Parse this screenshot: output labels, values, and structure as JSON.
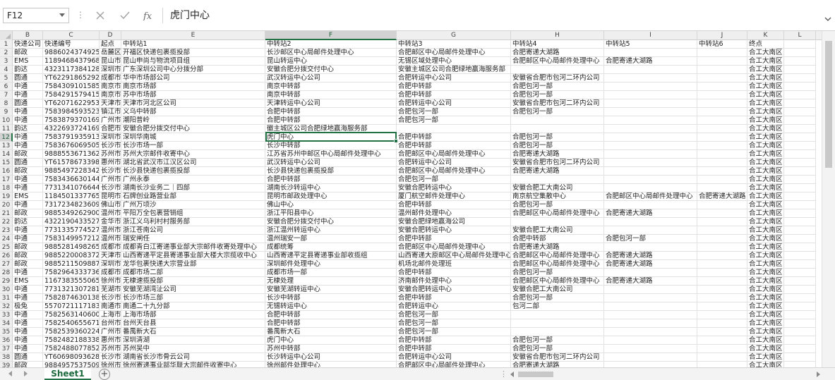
{
  "namebox": "F12",
  "formula": "虎门中心",
  "sheet_tab": "Sheet1",
  "add_sheet": "+",
  "columns": [
    "B",
    "C",
    "D",
    "E",
    "F",
    "G",
    "H",
    "I",
    "J",
    "K",
    "L"
  ],
  "selected_column": "F",
  "selected_row": "12",
  "rows": [
    {
      "n": "1",
      "c": [
        "快递公司",
        "快递编号",
        "起点",
        "中转站1",
        "中转站2",
        "中转站3",
        "中转站4",
        "中转站5",
        "中转站6",
        "终点",
        ""
      ]
    },
    {
      "n": "2",
      "c": [
        "邮政",
        "9886024374925",
        "岳麓区",
        "开福区快递包裹揽投部",
        "长沙邮区中心局邮件处理中心",
        "合肥邮区中心局邮件处理中心",
        "合肥寄递大湖路",
        "",
        "",
        "合工大南区",
        ""
      ]
    },
    {
      "n": "3",
      "c": [
        "EMS",
        "1189468437968",
        "昆山市",
        "昆山申尚与物流项目组",
        "昆山转运中心",
        "无锡区域处理中心",
        "合肥邮区中心局邮件处理中心",
        "合肥寄递大湖路",
        "",
        "合工大南区",
        ""
      ]
    },
    {
      "n": "4",
      "c": [
        "韵达",
        "432311738412858",
        "深圳市",
        "广东深圳公司中心分拨分部",
        "安徽合肥分拨交付中心",
        "安徽主城区公司合肥绿地赢海服务部",
        "",
        "",
        "",
        "合工大南区",
        ""
      ]
    },
    {
      "n": "5",
      "c": [
        "圆通",
        "YT6229186529207",
        "成都市",
        "华中市场部公司",
        "武汉转运中心公司",
        "合肥转运中心公司",
        "安徽省合肥市包河二环内公司",
        "",
        "",
        "合工大南区",
        ""
      ]
    },
    {
      "n": "6",
      "c": [
        "中通",
        "75843091015853",
        "南京市",
        "南京市场部",
        "南京中转部",
        "合肥中转部",
        "合肥包河一部",
        "",
        "",
        "合工大南区",
        ""
      ]
    },
    {
      "n": "7",
      "c": [
        "中通",
        "75842915794157",
        "南京市",
        "苏中市场部",
        "南京中转部",
        "合肥中转部",
        "合肥包河一部",
        "",
        "",
        "合工大南区",
        ""
      ]
    },
    {
      "n": "8",
      "c": [
        "圆通",
        "YT6207162295369",
        "天津市",
        "天津市河北区公司",
        "天津转运中心公司",
        "合肥转运中心公司",
        "安徽省合肥市包河二环内公司",
        "",
        "",
        "合工大南区",
        ""
      ]
    },
    {
      "n": "9",
      "c": [
        "中通",
        "75839845935236",
        "镇江市",
        "义乌中转部",
        "合肥中转部",
        "合肥包河一部",
        "合肥包河一部",
        "",
        "",
        "合工大南区",
        ""
      ]
    },
    {
      "n": "10",
      "c": [
        "中通",
        "75838793701692",
        "广州市",
        "潮阳普岭",
        "合肥中转部",
        "合肥包河一部",
        "",
        "",
        "",
        "合工大南区",
        ""
      ]
    },
    {
      "n": "11",
      "c": [
        "韵达",
        "432269372416914",
        "合肥市",
        "安徽合肥分拨交付中心",
        "徽主城区公司合肥绿地赢海服务部",
        "",
        "",
        "",
        "",
        "合工大南区",
        ""
      ]
    },
    {
      "n": "12",
      "c": [
        "中通",
        "75837919359133",
        "深圳市",
        "深圳华南城",
        "虎门中心",
        "合肥中转部",
        "合肥包河一部",
        "",
        "",
        "合工大南区",
        ""
      ]
    },
    {
      "n": "13",
      "c": [
        "中通",
        "75836760695054",
        "长沙市",
        "长沙市场一部",
        "长沙中转部",
        "合肥中转部",
        "合肥包河一部",
        "",
        "",
        "合工大南区",
        ""
      ]
    },
    {
      "n": "14",
      "c": [
        "邮政",
        "9888553671362",
        "苏州市",
        "苏州大宗邮件收寄中心",
        "江苏省苏州中邮区中心局邮件处理中心",
        "合肥邮区中心局邮件处理中心",
        "合肥寄递大湖路",
        "",
        "",
        "合工大南区",
        ""
      ]
    },
    {
      "n": "15",
      "c": [
        "圆通",
        "YT6157867339867",
        "惠州市",
        "湖北省武汉市江汉区公司",
        "武汉转运中心公司",
        "合肥转运中心公司",
        "安徽省合肥市包河二环内公司",
        "",
        "",
        "合工大南区",
        ""
      ]
    },
    {
      "n": "16",
      "c": [
        "邮政",
        "9885497228342",
        "长沙市",
        "长沙县快递包裹揽投部",
        "长沙县快递包裹揽投部",
        "合肥邮区中心局邮件处理中心",
        "合肥寄递大湖路",
        "",
        "",
        "合工大南区",
        ""
      ]
    },
    {
      "n": "17",
      "c": [
        "中通",
        "75834366301446",
        "广州市",
        "广州永泰",
        "合肥中转部",
        "合肥包河一部",
        "",
        "",
        "",
        "合工大南区",
        ""
      ]
    },
    {
      "n": "18",
      "c": [
        "中通",
        "773134107664496",
        "长沙市",
        "湖南长沙业务二｜四部",
        "湖南长沙转运中心",
        "安徽合肥转运中心",
        "安徽合肥工大南公司",
        "",
        "",
        "合工大南区",
        ""
      ]
    },
    {
      "n": "19",
      "c": [
        "EMS",
        "1184501337765",
        "昆明市",
        "石牌创业路营业部",
        "昆明市邮政处理中心",
        "厦门航空邮件处理中心",
        "南京航空集散中心",
        "合肥邮区中心局邮件处理中心",
        "合肥寄递大湖路",
        "合工大南区",
        ""
      ]
    },
    {
      "n": "20",
      "c": [
        "中通",
        "73172348236092",
        "佛山市",
        "广州万顷沙",
        "佛山中心",
        "合肥中转部",
        "合肥包河一部",
        "",
        "",
        "合工大南区",
        ""
      ]
    },
    {
      "n": "21",
      "c": [
        "邮政",
        "9885349262900",
        "温州市",
        "平阳万全包裹营销组",
        "浙江平阳县中心",
        "温州邮件处理中心",
        "合肥邮区中心局邮件处理中心",
        "合肥寄递大湖路",
        "",
        "合工大南区",
        ""
      ]
    },
    {
      "n": "22",
      "c": [
        "韵达",
        "432219043352741",
        "金华市",
        "浙江义乌利村村服务部",
        "安徽合肥分拨交付中心",
        "安徽合肥绿地赢海公司",
        "",
        "",
        "",
        "合工大南区",
        ""
      ]
    },
    {
      "n": "23",
      "c": [
        "中通",
        "773133577452721",
        "温州市",
        "浙江苍南公司",
        "浙江温州转运中心",
        "安徽合肥转运中心",
        "安徽合肥工大南公司",
        "",
        "",
        "合工大南区",
        ""
      ]
    },
    {
      "n": "24",
      "c": [
        "中通",
        "75831499572125",
        "温州市",
        "瑞安闸任",
        "温州瑞安一部",
        "合肥中转部",
        "合肥中转部",
        "合肥包河一部",
        "",
        "合工大南区",
        ""
      ]
    },
    {
      "n": "25",
      "c": [
        "邮政",
        "9885281498265",
        "成都市",
        "成都青白江寄递事业部大宗邮件收寄处理中心",
        "成都统筹",
        "合肥邮区中心局邮件处理中心",
        "合肥寄递大湖路",
        "",
        "",
        "合工大南区",
        ""
      ]
    },
    {
      "n": "26",
      "c": [
        "邮政",
        "9885220008372",
        "天津市",
        "山西寄递平定县寄递事业部大楼大宗揽收中心",
        "山西寄递平定县寄递事业部收揽组",
        "山西寄递大原邮区中心局邮件处理中心",
        "合肥邮区中心局邮件处理中心",
        "合肥寄递大湖路",
        "",
        "合工大南区",
        ""
      ]
    },
    {
      "n": "27",
      "c": [
        "邮政",
        "9885211509887",
        "深圳市",
        "龙华包裹快递大宗营业部",
        "深圳邮件处理中心",
        "机场北邮件处理班",
        "合肥邮区中心局邮件处理中心",
        "合肥寄递大湖路",
        "",
        "合工大南区",
        ""
      ]
    },
    {
      "n": "28",
      "c": [
        "中通",
        "75829643337365",
        "成都市",
        "成都市场二部",
        "成都市场一部",
        "合肥中转部",
        "合肥包河一部",
        "",
        "",
        "合工大南区",
        ""
      ]
    },
    {
      "n": "29",
      "c": [
        "EMS",
        "1167383555065",
        "徐州市",
        "无棣速揽投部",
        "无棣处理",
        "济南邮件处理中心",
        "合肥邮区中心局邮件处理中心",
        "合肥寄递大湖路",
        "",
        "合工大南区",
        ""
      ]
    },
    {
      "n": "30",
      "c": [
        "中通",
        "773132130728197",
        "芜湖市",
        "安徽芜湖湾沚公司",
        "安徽芜湖转运中心",
        "安徽合肥转运中心",
        "安徽合肥工大南公司",
        "",
        "",
        "合工大南区",
        ""
      ]
    },
    {
      "n": "31",
      "c": [
        "中通",
        "75828746301384",
        "长沙市",
        "长沙市场三部",
        "长沙中转部",
        "合肥中转部",
        "合肥包河一部",
        "",
        "",
        "合工大南区",
        ""
      ]
    },
    {
      "n": "32",
      "c": [
        "极兔",
        "557072111718371",
        "南通市",
        "南通二十九分部",
        "无锡转运中心",
        "合肥转运中心",
        "包河二部",
        "",
        "",
        "合工大南区",
        ""
      ]
    },
    {
      "n": "33",
      "c": [
        "中通",
        "75825631406007",
        "上海市",
        "上海市场部",
        "合肥中转部",
        "合肥包河一部",
        "",
        "",
        "",
        "合工大南区",
        ""
      ]
    },
    {
      "n": "34",
      "c": [
        "中通",
        "75825406556718",
        "台州市",
        "台州天台县",
        "合肥中转部",
        "合肥包河一部",
        "",
        "",
        "",
        "合工大南区",
        ""
      ]
    },
    {
      "n": "35",
      "c": [
        "中通",
        "75825393602246",
        "广州市",
        "番禺新大石",
        "番禺新大石",
        "合肥包河一部",
        "",
        "",
        "",
        "合工大南区",
        ""
      ]
    },
    {
      "n": "36",
      "c": [
        "中通",
        "75824821883382",
        "惠州市",
        "深圳清湖",
        "虎门中心",
        "合肥中转部",
        "合肥包河一部",
        "",
        "",
        "合工大南区",
        ""
      ]
    },
    {
      "n": "37",
      "c": [
        "中通",
        "75824880778520",
        "苏州市",
        "苏州吴中",
        "苏州中转部",
        "合肥中转部",
        "合肥包河一部",
        "",
        "",
        "合工大南区",
        ""
      ]
    },
    {
      "n": "38",
      "c": [
        "圆通",
        "YT6069809362818",
        "长沙市",
        "湖南省长沙市骨云公司",
        "长沙转运中心公司",
        "合肥转运中心公司",
        "安徽省合肥市包河二环内公司",
        "",
        "",
        "合工大南区",
        ""
      ]
    },
    {
      "n": "39",
      "c": [
        "邮政",
        "9884957537509",
        "徐州市",
        "徐州寄递事业部华联大宗邮件收寄中心",
        "徐州邮件处理中心",
        "合肥邮区中心局邮件处理中心",
        "合肥寄递大湖路",
        "",
        "",
        "合工大南区",
        ""
      ]
    }
  ]
}
